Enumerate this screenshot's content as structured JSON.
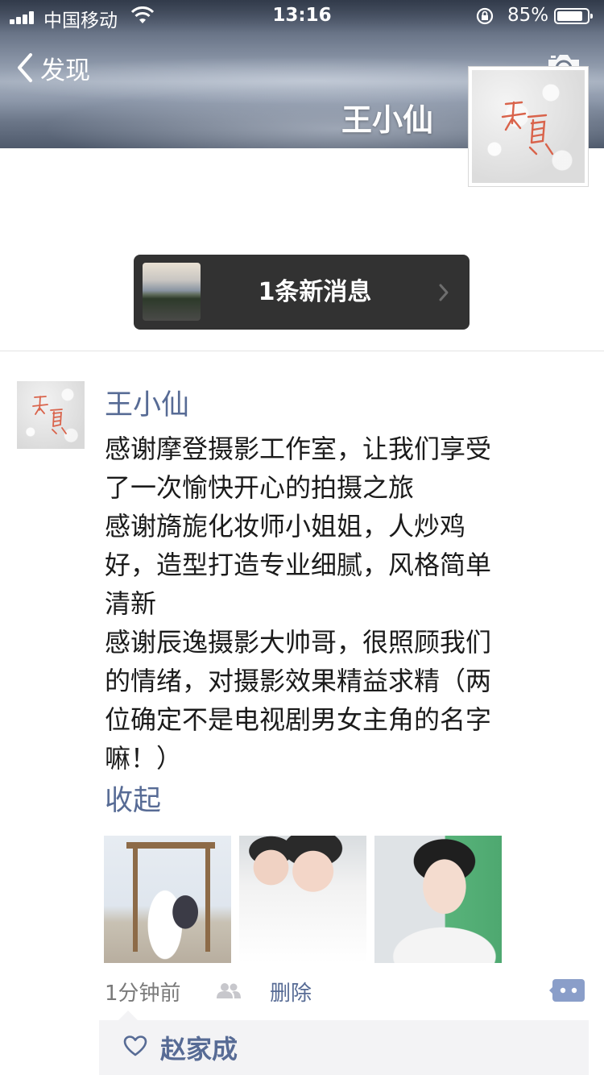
{
  "status_bar": {
    "carrier": "中国移动",
    "time": "13:16",
    "battery": "85%",
    "battery_level": 0.85,
    "icons": [
      "signal-icon",
      "wifi-icon",
      "rotation-lock-icon",
      "battery-icon"
    ]
  },
  "nav": {
    "back_label": "发现",
    "back_icon": "chevron-left-icon",
    "camera_icon": "camera-icon"
  },
  "profile": {
    "name": "王小仙"
  },
  "new_message": {
    "label": "1条新消息",
    "icon": "chevron-right-icon"
  },
  "post": {
    "author": "王小仙",
    "lines": [
      "感谢摩登摄影工作室，让我们享受",
      "了一次愉快开心的拍摄之旅",
      "感谢旖旎化妆师小姐姐，人炒鸡",
      "好，造型打造专业细腻，风格简单",
      "清新",
      "感谢辰逸摄影大帅哥，很照顾我们",
      "的情绪，对摄影效果精益求精（两",
      "位确定不是电视剧男女主角的名字",
      "嘛！）"
    ],
    "collapse_label": "收起",
    "photos": [
      "wedding-photo",
      "selfie-photo",
      "bride-photo"
    ],
    "time": "1分钟前",
    "delete_label": "删除",
    "likes": [
      "赵家成"
    ]
  },
  "colors": {
    "link": "#576b95",
    "pill_bg": "#323232",
    "likes_bg": "#f3f3f5"
  }
}
